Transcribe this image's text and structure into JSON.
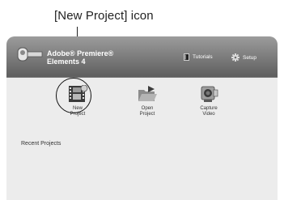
{
  "callout": {
    "label": "[New Project] icon"
  },
  "header": {
    "app_name_line1": "Adobe® Premiere®",
    "app_name_line2": "Elements 4",
    "tutorials_label": "Tutorials",
    "setup_label": "Setup"
  },
  "actions": [
    {
      "line1": "New",
      "line2": "Project",
      "icon": "film-clip-icon"
    },
    {
      "line1": "Open",
      "line2": "Project",
      "icon": "open-folder-icon"
    },
    {
      "line1": "Capture",
      "line2": "Video",
      "icon": "camcorder-icon"
    }
  ],
  "recent": {
    "title": "Recent Projects"
  },
  "colors": {
    "header_top": "#9c9c9c",
    "header_bottom": "#5e5e5e",
    "body_background": "#ececec",
    "callout": "#222222"
  }
}
